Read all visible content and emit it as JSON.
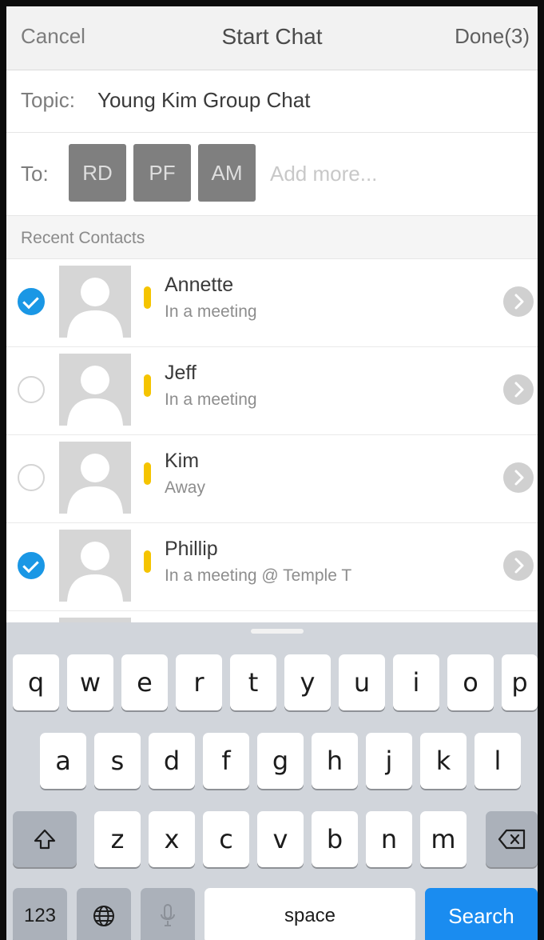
{
  "nav": {
    "cancel": "Cancel",
    "title": "Start Chat",
    "done": "Done(3)"
  },
  "topic": {
    "label": "Topic:",
    "value": "Young Kim Group Chat"
  },
  "to": {
    "label": "To:",
    "chips": [
      "RD",
      "PF",
      "AM"
    ],
    "placeholder": "Add more..."
  },
  "recent_contacts": {
    "title": "Recent Contacts",
    "items": [
      {
        "name": "Annette",
        "status": "In a meeting",
        "checked": true
      },
      {
        "name": "Jeff",
        "status": "In a meeting",
        "checked": false
      },
      {
        "name": "Kim",
        "status": "Away",
        "checked": false
      },
      {
        "name": "Phillip",
        "status": "In a meeting @ Temple T",
        "checked": true
      }
    ]
  },
  "keyboard": {
    "row1": [
      "q",
      "w",
      "e",
      "r",
      "t",
      "y",
      "u",
      "i",
      "o",
      "p"
    ],
    "row2": [
      "a",
      "s",
      "d",
      "f",
      "g",
      "h",
      "j",
      "k",
      "l"
    ],
    "row3": [
      "z",
      "x",
      "c",
      "v",
      "b",
      "n",
      "m"
    ],
    "numbers": "123",
    "space": "space",
    "search": "Search"
  },
  "colors": {
    "accent": "#1a97e5",
    "presence_busy": "#f5c400",
    "search_key": "#1a8cf0"
  }
}
